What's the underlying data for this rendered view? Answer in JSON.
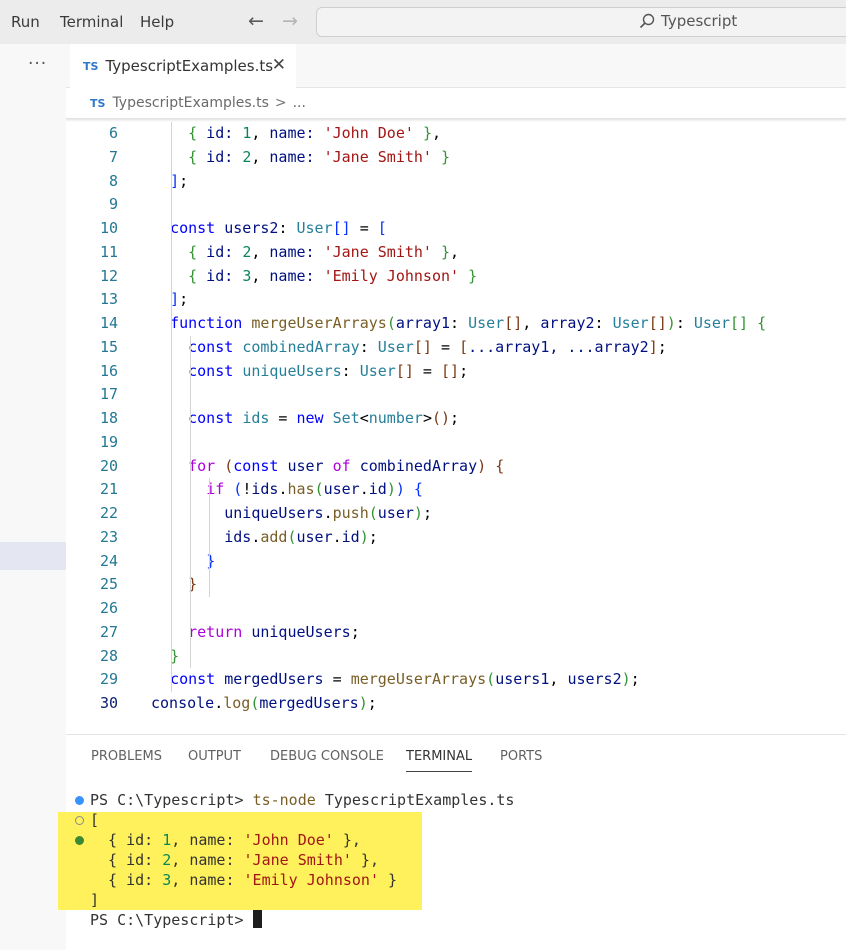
{
  "menu": [
    "Run",
    "Terminal",
    "Help"
  ],
  "search": {
    "label": "Typescript"
  },
  "activity": {
    "more_label": "···"
  },
  "tab": {
    "badge": "TS",
    "label": "TypescriptExamples.ts",
    "close": "✕"
  },
  "breadcrumb": {
    "badge": "TS",
    "file": "TypescriptExamples.ts",
    "sep": ">",
    "more": "..."
  },
  "editor": {
    "first_line": 6,
    "active_line": 30,
    "lines": [
      {
        "n": "6",
        "t": [
          [
            "    ",
            ""
          ],
          [
            "{",
            "b1"
          ],
          [
            " id: ",
            "vr"
          ],
          [
            "1",
            "nm"
          ],
          [
            ", ",
            "pl"
          ],
          [
            "name: ",
            "vr"
          ],
          [
            "'John Doe'",
            "st"
          ],
          [
            " ",
            "pl"
          ],
          [
            "}",
            "b1"
          ],
          [
            ",",
            "pl"
          ]
        ]
      },
      {
        "n": "7",
        "t": [
          [
            "    ",
            ""
          ],
          [
            "{",
            "b1"
          ],
          [
            " id: ",
            "vr"
          ],
          [
            "2",
            "nm"
          ],
          [
            ", ",
            "pl"
          ],
          [
            "name: ",
            "vr"
          ],
          [
            "'Jane Smith'",
            "st"
          ],
          [
            " ",
            "pl"
          ],
          [
            "}",
            "b1"
          ]
        ]
      },
      {
        "n": "8",
        "t": [
          [
            "  ",
            ""
          ],
          [
            "]",
            "b3"
          ],
          [
            ";",
            "pl"
          ]
        ]
      },
      {
        "n": "9",
        "t": []
      },
      {
        "n": "10",
        "t": [
          [
            "  ",
            ""
          ],
          [
            "const ",
            "kw"
          ],
          [
            "users2",
            "vr"
          ],
          [
            ": ",
            "pl"
          ],
          [
            "User",
            "ty"
          ],
          [
            "[]",
            "b3"
          ],
          [
            " = ",
            "pl"
          ],
          [
            "[",
            "b3"
          ]
        ]
      },
      {
        "n": "11",
        "t": [
          [
            "    ",
            ""
          ],
          [
            "{",
            "b1"
          ],
          [
            " id: ",
            "vr"
          ],
          [
            "2",
            "nm"
          ],
          [
            ", ",
            "pl"
          ],
          [
            "name: ",
            "vr"
          ],
          [
            "'Jane Smith'",
            "st"
          ],
          [
            " ",
            "pl"
          ],
          [
            "}",
            "b1"
          ],
          [
            ",",
            "pl"
          ]
        ]
      },
      {
        "n": "12",
        "t": [
          [
            "    ",
            ""
          ],
          [
            "{",
            "b1"
          ],
          [
            " id: ",
            "vr"
          ],
          [
            "3",
            "nm"
          ],
          [
            ", ",
            "pl"
          ],
          [
            "name: ",
            "vr"
          ],
          [
            "'Emily Johnson'",
            "st"
          ],
          [
            " ",
            "pl"
          ],
          [
            "}",
            "b1"
          ]
        ]
      },
      {
        "n": "13",
        "t": [
          [
            "  ",
            ""
          ],
          [
            "]",
            "b3"
          ],
          [
            ";",
            "pl"
          ]
        ]
      },
      {
        "n": "14",
        "t": [
          [
            "  ",
            ""
          ],
          [
            "function ",
            "kw"
          ],
          [
            "mergeUserArrays",
            "fn"
          ],
          [
            "(",
            "b1"
          ],
          [
            "array1",
            "vr"
          ],
          [
            ": ",
            "pl"
          ],
          [
            "User",
            "ty"
          ],
          [
            "[]",
            "b2"
          ],
          [
            ", ",
            "pl"
          ],
          [
            "array2",
            "vr"
          ],
          [
            ": ",
            "pl"
          ],
          [
            "User",
            "ty"
          ],
          [
            "[]",
            "b2"
          ],
          [
            ")",
            "b1"
          ],
          [
            ": ",
            "pl"
          ],
          [
            "User",
            "ty"
          ],
          [
            "[]",
            "b1"
          ],
          [
            " ",
            "pl"
          ],
          [
            "{",
            "b1"
          ]
        ]
      },
      {
        "n": "15",
        "t": [
          [
            "    ",
            ""
          ],
          [
            "const ",
            "kw"
          ],
          [
            "combinedArray",
            "ty"
          ],
          [
            ": ",
            "pl"
          ],
          [
            "User",
            "ty"
          ],
          [
            "[]",
            "b2"
          ],
          [
            " = ",
            "pl"
          ],
          [
            "[",
            "b2"
          ],
          [
            "...array1, ...array2",
            "vr"
          ],
          [
            "]",
            "b2"
          ],
          [
            ";",
            "pl"
          ]
        ]
      },
      {
        "n": "16",
        "t": [
          [
            "    ",
            ""
          ],
          [
            "const ",
            "kw"
          ],
          [
            "uniqueUsers",
            "ty"
          ],
          [
            ": ",
            "pl"
          ],
          [
            "User",
            "ty"
          ],
          [
            "[]",
            "b2"
          ],
          [
            " = ",
            "pl"
          ],
          [
            "[]",
            "b2"
          ],
          [
            ";",
            "pl"
          ]
        ]
      },
      {
        "n": "17",
        "t": []
      },
      {
        "n": "18",
        "t": [
          [
            "    ",
            ""
          ],
          [
            "const ",
            "kw"
          ],
          [
            "ids",
            "ty"
          ],
          [
            " = ",
            "pl"
          ],
          [
            "new ",
            "kw"
          ],
          [
            "Set",
            "ty"
          ],
          [
            "<",
            "pl"
          ],
          [
            "number",
            "ty"
          ],
          [
            ">",
            "pl"
          ],
          [
            "()",
            "b2"
          ],
          [
            ";",
            "pl"
          ]
        ]
      },
      {
        "n": "19",
        "t": []
      },
      {
        "n": "20",
        "t": [
          [
            "    ",
            ""
          ],
          [
            "for ",
            "ctl"
          ],
          [
            "(",
            "b2"
          ],
          [
            "const ",
            "kw"
          ],
          [
            "user ",
            "vr"
          ],
          [
            "of ",
            "ctl"
          ],
          [
            "combinedArray",
            "vr"
          ],
          [
            ")",
            "b2"
          ],
          [
            " ",
            "pl"
          ],
          [
            "{",
            "b2"
          ]
        ]
      },
      {
        "n": "21",
        "t": [
          [
            "      ",
            ""
          ],
          [
            "if ",
            "ctl"
          ],
          [
            "(",
            "b3"
          ],
          [
            "!",
            "pl"
          ],
          [
            "ids",
            "vr"
          ],
          [
            ".",
            "pl"
          ],
          [
            "has",
            "fn"
          ],
          [
            "(",
            "b1"
          ],
          [
            "user",
            "vr"
          ],
          [
            ".",
            "pl"
          ],
          [
            "id",
            "vr"
          ],
          [
            ")",
            "b1"
          ],
          [
            ")",
            "b3"
          ],
          [
            " ",
            "pl"
          ],
          [
            "{",
            "b3"
          ]
        ]
      },
      {
        "n": "22",
        "t": [
          [
            "        ",
            ""
          ],
          [
            "uniqueUsers",
            "vr"
          ],
          [
            ".",
            "pl"
          ],
          [
            "push",
            "fn"
          ],
          [
            "(",
            "b1"
          ],
          [
            "user",
            "vr"
          ],
          [
            ")",
            "b1"
          ],
          [
            ";",
            "pl"
          ]
        ]
      },
      {
        "n": "23",
        "t": [
          [
            "        ",
            ""
          ],
          [
            "ids",
            "vr"
          ],
          [
            ".",
            "pl"
          ],
          [
            "add",
            "fn"
          ],
          [
            "(",
            "b1"
          ],
          [
            "user",
            "vr"
          ],
          [
            ".",
            "pl"
          ],
          [
            "id",
            "vr"
          ],
          [
            ")",
            "b1"
          ],
          [
            ";",
            "pl"
          ]
        ]
      },
      {
        "n": "24",
        "t": [
          [
            "      ",
            ""
          ],
          [
            "}",
            "b3"
          ]
        ]
      },
      {
        "n": "25",
        "t": [
          [
            "    ",
            ""
          ],
          [
            "}",
            "b2"
          ]
        ]
      },
      {
        "n": "26",
        "t": []
      },
      {
        "n": "27",
        "t": [
          [
            "    ",
            ""
          ],
          [
            "return ",
            "ctl"
          ],
          [
            "uniqueUsers",
            "vr"
          ],
          [
            ";",
            "pl"
          ]
        ]
      },
      {
        "n": "28",
        "t": [
          [
            "  ",
            ""
          ],
          [
            "}",
            "b1"
          ]
        ]
      },
      {
        "n": "29",
        "t": [
          [
            "  ",
            ""
          ],
          [
            "const ",
            "kw"
          ],
          [
            "mergedUsers",
            "vr"
          ],
          [
            " = ",
            "pl"
          ],
          [
            "mergeUserArrays",
            "fn"
          ],
          [
            "(",
            "b1"
          ],
          [
            "users1",
            "vr"
          ],
          [
            ", ",
            "pl"
          ],
          [
            "users2",
            "vr"
          ],
          [
            ")",
            "b1"
          ],
          [
            ";",
            "pl"
          ]
        ]
      },
      {
        "n": "30",
        "t": [
          [
            "console",
            "vr"
          ],
          [
            ".",
            "pl"
          ],
          [
            "log",
            "fn"
          ],
          [
            "(",
            "b1"
          ],
          [
            "mergedUsers",
            "vr"
          ],
          [
            ")",
            "b1"
          ],
          [
            ";",
            "pl"
          ]
        ]
      }
    ]
  },
  "panel": {
    "tabs": [
      "PROBLEMS",
      "OUTPUT",
      "DEBUG CONSOLE",
      "TERMINAL",
      "PORTS"
    ],
    "active_tab": "TERMINAL"
  },
  "terminal": {
    "prompt": "PS C:\\Typescript>",
    "command": "ts-node",
    "command_arg": "TypescriptExamples.ts",
    "open_bracket": "[",
    "rows": [
      {
        "id": "1",
        "name": "'John Doe'",
        "trail": ","
      },
      {
        "id": "2",
        "name": "'Jane Smith'",
        "trail": ","
      },
      {
        "id": "3",
        "name": "'Emily Johnson'",
        "trail": ""
      }
    ],
    "close_bracket": "]",
    "final_prompt": "PS C:\\Typescript>"
  },
  "colors": {
    "highlight": "#fff04d",
    "terminal_dot_blue": "#3794ff",
    "terminal_dot_green": "#388a34"
  }
}
